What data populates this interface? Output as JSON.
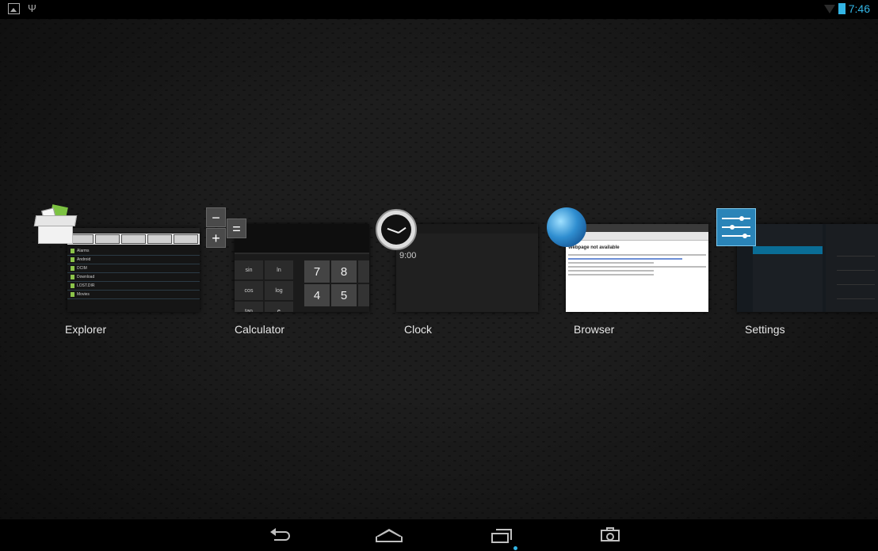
{
  "status_bar": {
    "time": "7:46",
    "left_icons": [
      "image-icon",
      "usb-icon"
    ],
    "right_icons": [
      "wifi-icon",
      "battery-icon"
    ],
    "accent_color": "#33b5e5"
  },
  "recent_apps": [
    {
      "label": "Explorer",
      "icon": "explorer-box-icon",
      "thumb_rows": [
        "Alarms",
        "Android",
        "DCIM",
        "Download",
        "LOST.DIR",
        "Movies"
      ]
    },
    {
      "label": "Calculator",
      "icon": "calculator-icon",
      "icon_keys": [
        "−",
        "=",
        "+"
      ],
      "thumb_fn_keys": [
        "sin",
        "ln",
        "cos",
        "log",
        "tan",
        "e"
      ],
      "thumb_num_keys": [
        "7",
        "8",
        "4",
        "5"
      ]
    },
    {
      "label": "Clock",
      "icon": "clock-icon",
      "thumb_time": "9:00"
    },
    {
      "label": "Browser",
      "icon": "globe-icon",
      "thumb_title": "Webpage not available"
    },
    {
      "label": "Settings",
      "icon": "settings-sliders-icon"
    }
  ],
  "nav_bar": {
    "buttons": [
      "back-icon",
      "home-icon",
      "recent-apps-icon",
      "screenshot-icon"
    ]
  }
}
